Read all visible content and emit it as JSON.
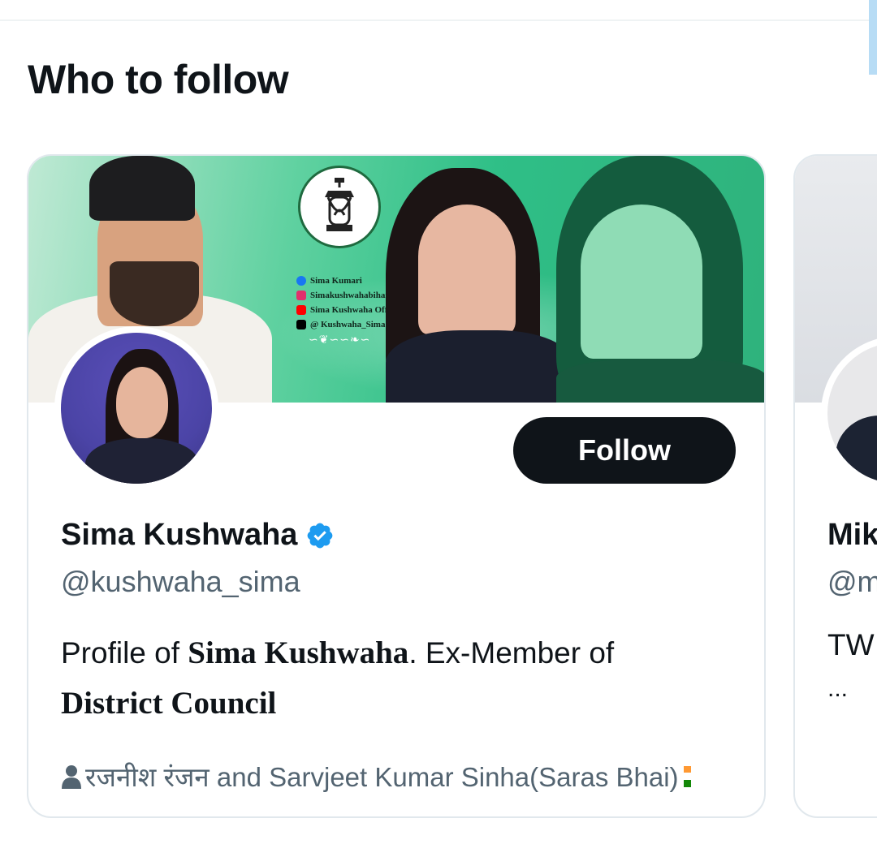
{
  "section": {
    "title": "Who to follow"
  },
  "card": {
    "banner": {
      "social": {
        "facebook": "Sima Kumari",
        "instagram": "Simakushwahabihar",
        "youtube": "Sima Kushwaha Official",
        "x": "@ Kushwaha_Sima"
      }
    },
    "follow_label": "Follow",
    "display_name": "Sima Kushwaha",
    "handle": "@kushwaha_sima",
    "bio": {
      "part1": "Profile of ",
      "bold1": "Sima Kushwaha",
      "part2": ". Ex-Member of",
      "bold2": "District Council"
    },
    "followed_by": "रजनीश रंजन and Sarvjeet Kumar Sinha(Saras Bhai)"
  },
  "next_card": {
    "display_name_partial": "Mik",
    "handle_partial": "@m",
    "bio_partial": "TW",
    "ellipsis": "..."
  },
  "colors": {
    "follow_bg": "#0f1419",
    "verified": "#1d9bf0",
    "secondary_text": "#536471",
    "banner_green": "#2fbf87"
  },
  "icons": {
    "verified": "verified-badge-icon",
    "person": "person-icon",
    "flag": "india-flag-icon",
    "lantern": "lantern-icon"
  }
}
